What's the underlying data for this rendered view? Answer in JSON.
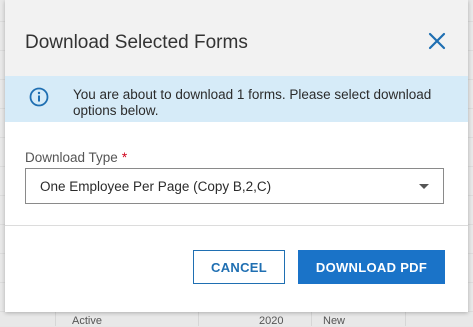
{
  "dialog": {
    "title": "Download Selected Forms",
    "close_icon": "close-icon",
    "info_icon": "info-icon",
    "info_message": "You are about to download 1 forms. Please select download options below.",
    "field": {
      "label": "Download Type",
      "required_marker": "*",
      "selected_value": "One Employee Per Page (Copy B,2,C)"
    },
    "buttons": {
      "cancel": "CANCEL",
      "download": "DOWNLOAD PDF"
    }
  },
  "background_peek": {
    "status": "Active",
    "year": "2020",
    "type": "New"
  },
  "colors": {
    "primary": "#1a73c8",
    "info_bg": "#d6ebf8",
    "required": "#d0021b",
    "header_bg": "#f2f2f2"
  }
}
